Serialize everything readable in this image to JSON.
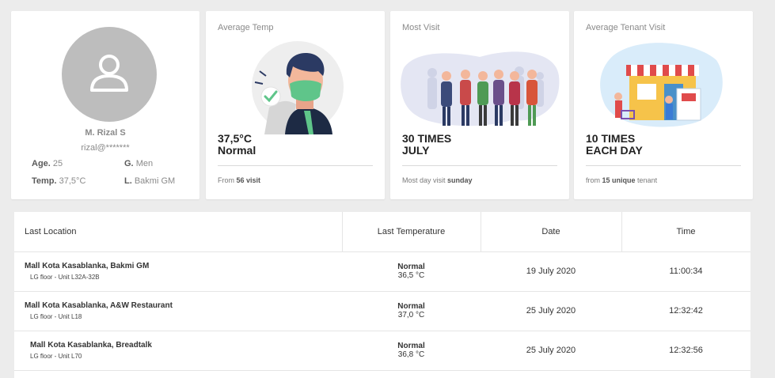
{
  "profile": {
    "name": "M. Rizal S",
    "email": "rizal@*******",
    "age_label": "Age.",
    "age": "25",
    "gender_label": "G.",
    "gender": "Men",
    "temp_label": "Temp.",
    "temp": "37,5°C",
    "location_label": "L.",
    "location": "Bakmi GM"
  },
  "cards": {
    "temp": {
      "label": "Average Temp",
      "value_line1": "37,5°C",
      "value_line2": "Normal",
      "foot_prefix": "From",
      "foot_bold": "56 visit",
      "foot_suffix": ""
    },
    "visit": {
      "label": "Most Visit",
      "value_line1": "30 TIMES",
      "value_line2": "JULY",
      "foot_prefix": "Most day visit",
      "foot_bold": "sunday",
      "foot_suffix": ""
    },
    "tenant": {
      "label": "Average Tenant Visit",
      "value_line1": "10 TIMES",
      "value_line2": "EACH DAY",
      "foot_prefix": "from",
      "foot_bold": "15 unique",
      "foot_suffix": "tenant"
    }
  },
  "table": {
    "headers": {
      "location": "Last Location",
      "temperature": "Last Temperature",
      "date": "Date",
      "time": "Time"
    },
    "rows": [
      {
        "location": "Mall Kota Kasablanka, Bakmi GM",
        "unit": "LG floor - Unit L32A-32B",
        "status": "Normal",
        "temp": "36,5 °C",
        "date": "19 July 2020",
        "time": "11:00:34"
      },
      {
        "location": "Mall Kota Kasablanka, A&W Restaurant",
        "unit": "LG floor - Unit L18",
        "status": "Normal",
        "temp": "37,0 °C",
        "date": "25 July 2020",
        "time": "12:32:42"
      },
      {
        "location": "Mall Kota Kasablanka, Breadtalk",
        "unit": "LG floor - Unit L70",
        "status": "Normal",
        "temp": "36,8 °C",
        "date": "25 July 2020",
        "time": "12:32:56"
      }
    ]
  },
  "colors": {
    "background": "#ececec",
    "avatar": "#bdbdbd",
    "mask_green": "#5fc58a",
    "illus_bg": "#e4e6f3"
  },
  "icons": {
    "avatar": "user-icon",
    "temp": "masked-person-illustration",
    "visit": "crowd-illustration",
    "tenant": "storefront-illustration"
  }
}
